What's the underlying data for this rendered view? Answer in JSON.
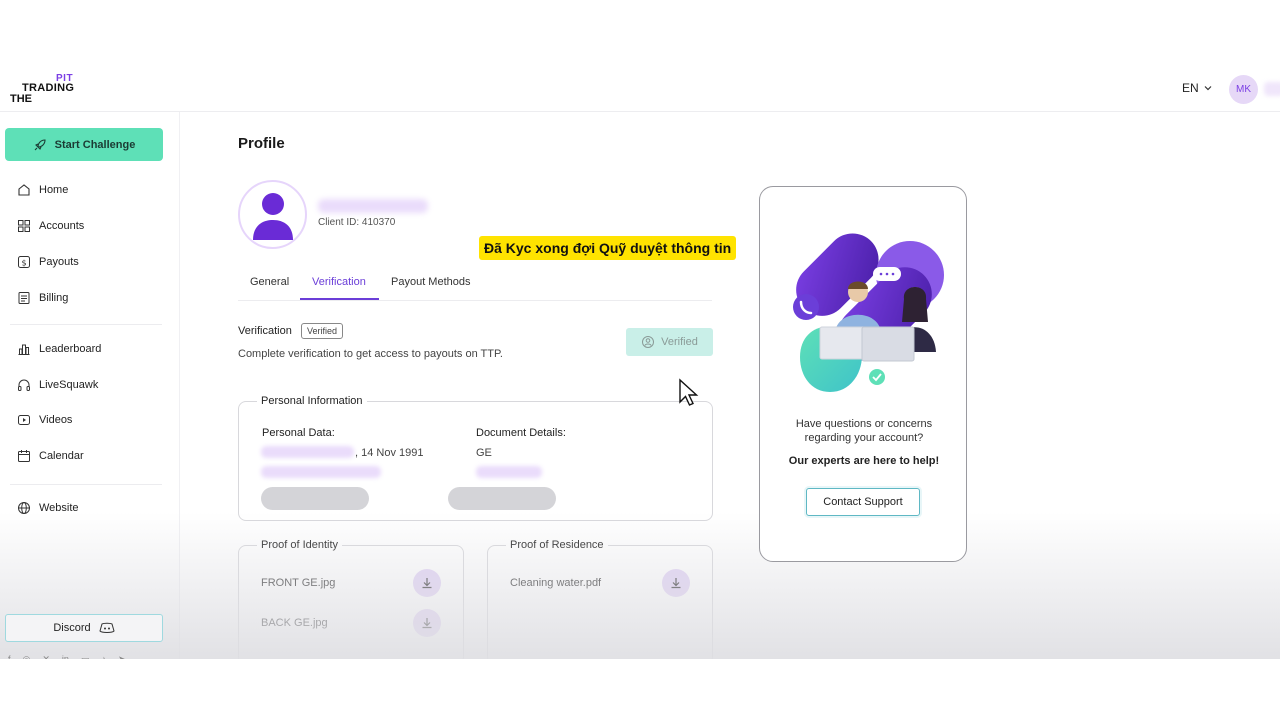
{
  "header": {
    "logo_top": "PIT",
    "logo_middle": "TRADING",
    "logo_bottom": "THE",
    "language": "EN",
    "avatar_initials": "MK"
  },
  "sidebar": {
    "cta_label": "Start Challenge",
    "items": [
      {
        "label": "Home",
        "icon": "home-icon"
      },
      {
        "label": "Accounts",
        "icon": "grid-icon"
      },
      {
        "label": "Payouts",
        "icon": "dollar-icon"
      },
      {
        "label": "Billing",
        "icon": "document-icon"
      },
      {
        "label": "Leaderboard",
        "icon": "bar-chart-icon"
      },
      {
        "label": "LiveSquawk",
        "icon": "headphones-icon"
      },
      {
        "label": "Videos",
        "icon": "play-icon"
      },
      {
        "label": "Calendar",
        "icon": "calendar-icon"
      },
      {
        "label": "Website",
        "icon": "globe-icon"
      }
    ],
    "discord_label": "Discord"
  },
  "profile": {
    "title": "Profile",
    "client_id": "Client ID: 410370",
    "tabs": [
      "General",
      "Verification",
      "Payout Methods"
    ],
    "active_tab": "Verification"
  },
  "overlay_note": "Đã Kyc xong đợi Quỹ duyệt thông tin",
  "verification": {
    "label": "Verification",
    "badge": "Verified",
    "description": "Complete verification to get access to payouts on TTP.",
    "button_label": "Verified"
  },
  "personal_info": {
    "legend": "Personal Information",
    "personal_data_label": "Personal Data:",
    "dob": ", 14 Nov 1991",
    "document_label": "Document Details:",
    "document_country": "GE"
  },
  "proof_identity": {
    "legend": "Proof of Identity",
    "files": [
      "FRONT GE.jpg",
      "BACK GE.jpg"
    ]
  },
  "proof_residence": {
    "legend": "Proof of Residence",
    "files": [
      "Cleaning water.pdf"
    ]
  },
  "support": {
    "question": "Have questions or concerns regarding your account?",
    "bold": "Our experts are here to help!",
    "button": "Contact Support"
  },
  "colors": {
    "accent": "#6b3ed8",
    "cta": "#5ee0b7",
    "highlight": "#ffe300"
  }
}
